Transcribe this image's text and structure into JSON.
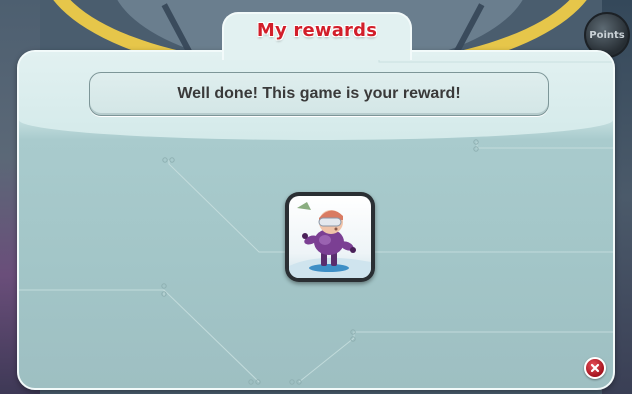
{
  "hud": {
    "points_label": "Points"
  },
  "dialog": {
    "title": "My rewards",
    "message": "Well done! This game is your reward!",
    "reward_item": {
      "icon": "snowboarder-game-icon"
    },
    "close_icon": "close-icon"
  },
  "colors": {
    "title_red": "#d21e2a",
    "dialog_bg": "#a9cbcd",
    "close_red": "#c0202b"
  }
}
